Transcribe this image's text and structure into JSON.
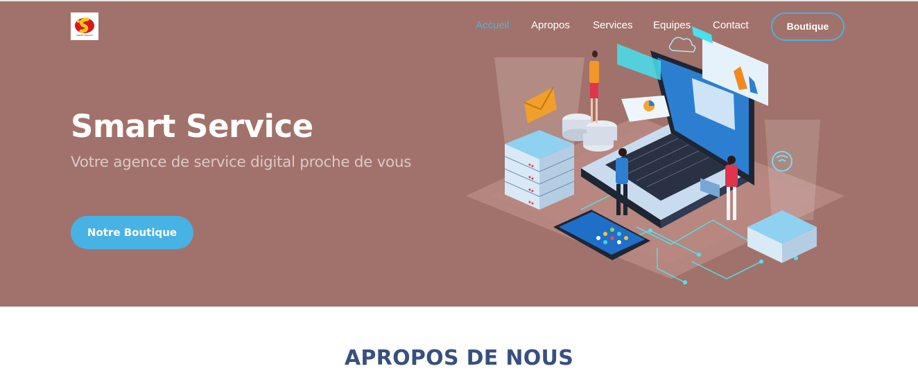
{
  "brand": {
    "logo_text": "SMART SERVICE",
    "colors": {
      "hero_bg": "#a1726b",
      "accent": "#47b2e4",
      "heading": "#37517e"
    }
  },
  "nav": {
    "items": [
      {
        "label": "Accueil",
        "active": true
      },
      {
        "label": "Apropos",
        "active": false
      },
      {
        "label": "Services",
        "active": false
      },
      {
        "label": "Equipes",
        "active": false
      },
      {
        "label": "Contact",
        "active": false
      }
    ],
    "cta_label": "Boutique"
  },
  "hero": {
    "title": "Smart Service",
    "subtitle": "Votre agence de service digital proche de vous",
    "button_label": "Notre Boutique",
    "illustration_icon": "isometric-digital-services-illustration"
  },
  "about": {
    "heading": "APROPOS DE NOUS"
  }
}
